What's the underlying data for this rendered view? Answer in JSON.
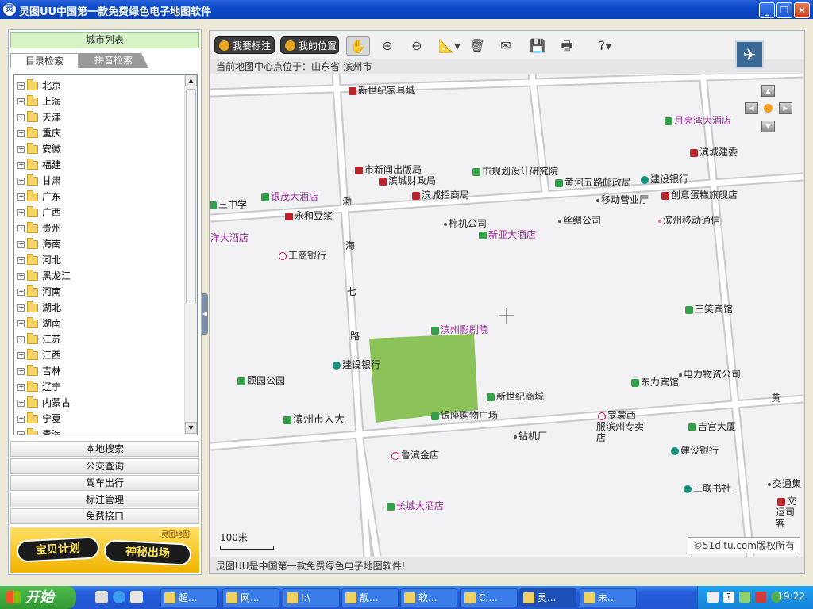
{
  "window": {
    "title": "灵图UU中国第一款免费绿色电子地图软件",
    "icon_name": "app-icon"
  },
  "sidebar": {
    "header": "城市列表",
    "tabs": [
      "目录检索",
      "拼音检索"
    ],
    "provinces": [
      "北京",
      "上海",
      "天津",
      "重庆",
      "安徽",
      "福建",
      "甘肃",
      "广东",
      "广西",
      "贵州",
      "海南",
      "河北",
      "黑龙江",
      "河南",
      "湖北",
      "湖南",
      "江苏",
      "江西",
      "吉林",
      "辽宁",
      "内蒙古",
      "宁夏",
      "青海"
    ],
    "buttons": [
      "本地搜索",
      "公交查询",
      "驾车出行",
      "标注管理",
      "免费接口"
    ],
    "banner": {
      "left": "宝贝计划",
      "right": "神秘出场",
      "corner": "灵图地图"
    }
  },
  "toolbar": {
    "my_mark": "我要标注",
    "my_location": "我的位置",
    "tools": [
      "hand-icon",
      "zoom-in-icon",
      "zoom-out-icon",
      "measure-icon",
      "delete-icon",
      "mail-icon",
      "save-icon",
      "print-icon",
      "help-icon"
    ]
  },
  "map": {
    "center_info": "当前地图中心点位于：山东省-滨州市",
    "scale": "100米",
    "copyright": "©51ditu.com版权所有",
    "status": "灵图UU是中国第一款免费绿色电子地图软件!",
    "road_labels": [
      "渤",
      "海",
      "七",
      "路",
      "黄"
    ],
    "pois": [
      {
        "text": "新世纪家具城",
        "color": "dark",
        "marker": "red"
      },
      {
        "text": "月亮湾大酒店",
        "color": "purple",
        "marker": "green"
      },
      {
        "text": "滨城建委",
        "color": "dark",
        "marker": "red"
      },
      {
        "text": "市新闻出版局",
        "color": "dark",
        "marker": "red"
      },
      {
        "text": "市规划设计研究院",
        "color": "dark",
        "marker": "green"
      },
      {
        "text": "滨城财政局",
        "color": "dark",
        "marker": "red"
      },
      {
        "text": "滨城招商局",
        "color": "dark",
        "marker": "red"
      },
      {
        "text": "黄河五路邮政局",
        "color": "dark",
        "marker": "green"
      },
      {
        "text": "建设银行",
        "color": "dark",
        "marker": "teal"
      },
      {
        "text": "三中学",
        "color": "dark",
        "marker": "green"
      },
      {
        "text": "银茂大酒店",
        "color": "purple",
        "marker": "green"
      },
      {
        "text": "移动营业厅",
        "color": "dark",
        "marker": "dot"
      },
      {
        "text": "创意蛋糕旗舰店",
        "color": "dark",
        "marker": "red"
      },
      {
        "text": "永和豆浆",
        "color": "dark",
        "marker": "red"
      },
      {
        "text": "棉机公司",
        "color": "dark",
        "marker": "dot"
      },
      {
        "text": "丝绸公司",
        "color": "dark",
        "marker": "dot"
      },
      {
        "text": "滨州移动通信",
        "color": "dark",
        "marker": "pinkdot"
      },
      {
        "text": "洋大酒店",
        "color": "purple",
        "marker": "none"
      },
      {
        "text": "新亚大酒店",
        "color": "purple",
        "marker": "green"
      },
      {
        "text": "工商银行",
        "color": "dark",
        "marker": "pink"
      },
      {
        "text": "三笑宾馆",
        "color": "dark",
        "marker": "green"
      },
      {
        "text": "滨州影剧院",
        "color": "purple",
        "marker": "green"
      },
      {
        "text": "建设银行",
        "color": "dark",
        "marker": "teal"
      },
      {
        "text": "颐园公园",
        "color": "dark",
        "marker": "green"
      },
      {
        "text": "东力宾馆",
        "color": "dark",
        "marker": "green"
      },
      {
        "text": "电力物资公司",
        "color": "dark",
        "marker": "dot"
      },
      {
        "text": "新世纪商城",
        "color": "dark",
        "marker": "green"
      },
      {
        "text": "滨州市人大",
        "color": "dark",
        "marker": "green"
      },
      {
        "text": "银座购物广场",
        "color": "dark",
        "marker": "green"
      },
      {
        "text": "罗蒙西服滨州专卖店",
        "color": "dark",
        "marker": "pink"
      },
      {
        "text": "钻机厂",
        "color": "dark",
        "marker": "dot"
      },
      {
        "text": "吉宫大厦",
        "color": "dark",
        "marker": "green"
      },
      {
        "text": "建设银行",
        "color": "dark",
        "marker": "teal"
      },
      {
        "text": "鲁滨金店",
        "color": "dark",
        "marker": "pink"
      },
      {
        "text": "三联书社",
        "color": "dark",
        "marker": "teal"
      },
      {
        "text": "交通集",
        "color": "dark",
        "marker": "dot"
      },
      {
        "text": "长城大酒店",
        "color": "purple",
        "marker": "green"
      },
      {
        "text": "交运司客",
        "color": "dark",
        "marker": "red"
      }
    ]
  },
  "taskbar": {
    "start": "开始",
    "tasks": [
      "超...",
      "网...",
      "I:\\",
      "靓...",
      "软...",
      "C:...",
      "灵...",
      "未..."
    ],
    "clock": "19:22"
  },
  "colors": {
    "park": "#8bc35a",
    "title_bar": "#0a49c8",
    "taskbar": "#245edb"
  }
}
